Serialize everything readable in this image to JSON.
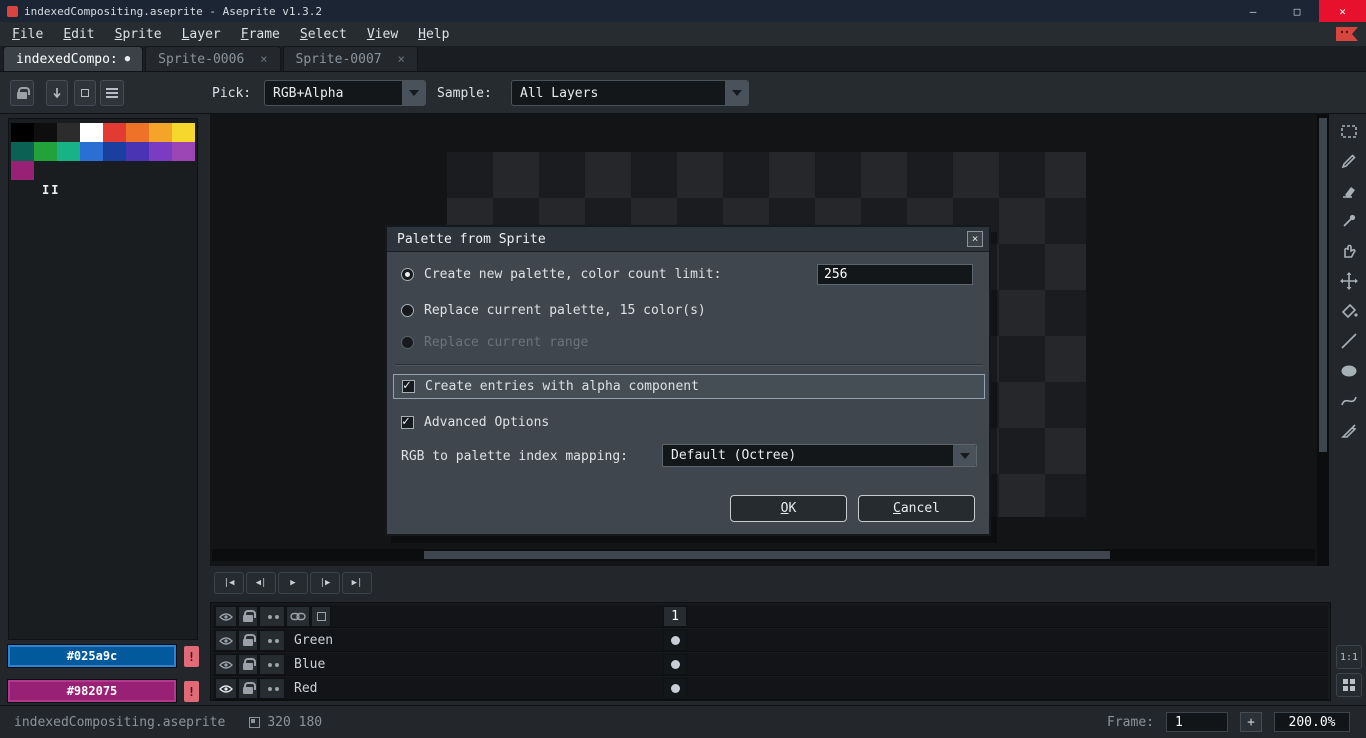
{
  "window": {
    "title": "indexedCompositing.aseprite - Aseprite v1.3.2",
    "minimize": "–",
    "maximize": "□",
    "close": "✕"
  },
  "menu": {
    "items": [
      "File",
      "Edit",
      "Sprite",
      "Layer",
      "Frame",
      "Select",
      "View",
      "Help"
    ]
  },
  "tabs": {
    "active": {
      "label": "indexedCompo:",
      "modified_dot": "●"
    },
    "others": [
      {
        "label": "Sprite-0006",
        "close": "×"
      },
      {
        "label": "Sprite-0007",
        "close": "×"
      }
    ]
  },
  "context_bar": {
    "pick_label": "Pick:",
    "pick_value": "RGB+Alpha",
    "sample_label": "Sample:",
    "sample_value": "All Layers"
  },
  "palette": {
    "colors": [
      "#000000",
      "#0e0e0e",
      "#2c2c2c",
      "#ffffff",
      "#e23c32",
      "#ee7227",
      "#f4a428",
      "#f6d72b",
      "#0c6155",
      "#23a13b",
      "#18b287",
      "#2b6fd4",
      "#1b3f9e",
      "#4a34b4",
      "#7a3cc0",
      "#9b46b4",
      "#982075"
    ],
    "index_marker": "II",
    "foreground": {
      "hex": "#025a9c",
      "warning": "!"
    },
    "background": {
      "hex": "#982075",
      "warning": "!"
    }
  },
  "playback": {
    "buttons": [
      "|◀",
      "◀|",
      "▶",
      "|▶",
      "▶|"
    ]
  },
  "tools": [
    "rectangular-marquee",
    "pencil",
    "eraser",
    "eyedropper",
    "hand",
    "move",
    "paint-bucket",
    "line",
    "ellipse",
    "contour",
    "slice"
  ],
  "dialog": {
    "title": "Palette from Sprite",
    "close": "×",
    "radio_new_palette": {
      "label": "Create new palette, color count limit:",
      "value": "256",
      "checked": true
    },
    "radio_replace_palette": {
      "label": "Replace current palette, 15 color(s)",
      "checked": false
    },
    "radio_replace_range": {
      "label": "Replace current range",
      "checked": false,
      "disabled": true
    },
    "checkbox_alpha": {
      "label": "Create entries with alpha component",
      "checked": true,
      "focused": true
    },
    "checkbox_advanced": {
      "label": "Advanced Options",
      "checked": true
    },
    "mapping_label": "RGB to palette index mapping:",
    "mapping_value": "Default (Octree)",
    "ok_label": "OK",
    "cancel_label": "Cancel"
  },
  "timeline": {
    "frame_header": "1",
    "layers": [
      {
        "name": "Green"
      },
      {
        "name": "Blue"
      },
      {
        "name": "Red"
      }
    ]
  },
  "status_bar": {
    "filename": "indexedCompositing.aseprite",
    "canvas_size": "320 180",
    "frame_label": "Frame:",
    "frame_value": "1",
    "add_frame_label": "+",
    "zoom_value": "200.0%"
  },
  "corner": {
    "pixel_ratio": "1:1"
  },
  "colors": {
    "titlebar": "#1c2534",
    "close_button_red": "#e8112d",
    "logo_red": "#d8453e",
    "dialog_bg": "#3f464d",
    "accent_foreground": "#025a9c",
    "accent_background": "#982075"
  }
}
